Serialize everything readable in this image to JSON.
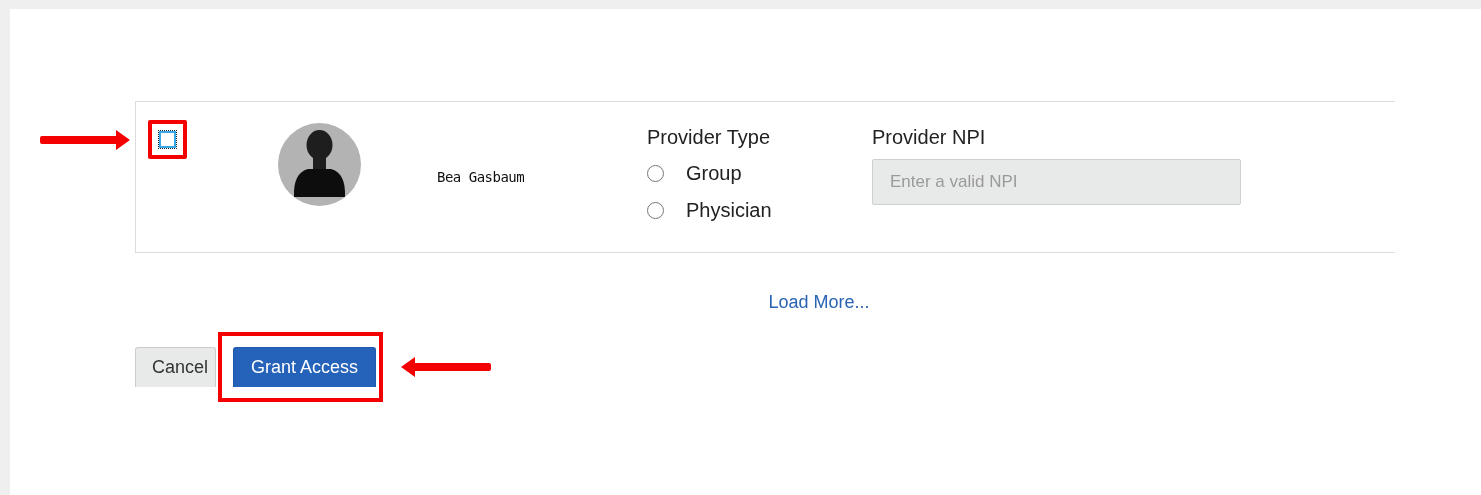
{
  "request": {
    "checkbox": {
      "checked": false,
      "highlighted": true
    },
    "name": "Bea Gasbaum",
    "provider_type": {
      "label": "Provider Type",
      "options": [
        {
          "label": "Group",
          "selected": false
        },
        {
          "label": "Physician",
          "selected": false
        }
      ]
    },
    "provider_npi": {
      "label": "Provider NPI",
      "placeholder": "Enter a valid NPI"
    }
  },
  "load_more": "Load More...",
  "buttons": [
    {
      "label": "Cancel",
      "kind": "secondary",
      "highlighted": false
    },
    {
      "label": "Grant Access",
      "kind": "primary",
      "highlighted": true
    }
  ]
}
